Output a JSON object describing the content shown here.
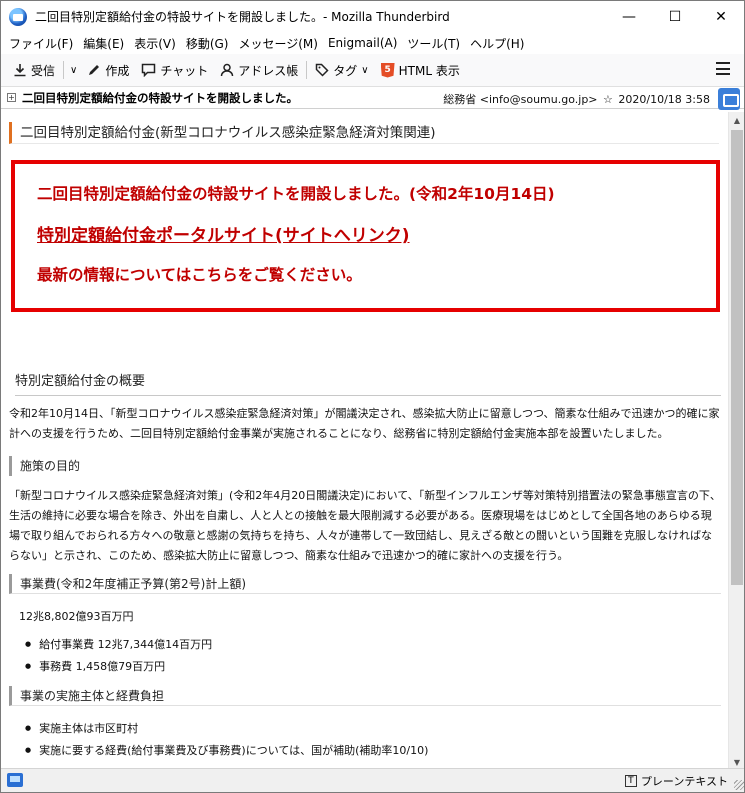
{
  "window": {
    "title": "二回目特別定額給付金の特設サイトを開設しました。- Mozilla Thunderbird",
    "minimize_glyph": "—",
    "maximize_glyph": "☐",
    "close_glyph": "✕"
  },
  "menubar": {
    "items": [
      "ファイル(F)",
      "編集(E)",
      "表示(V)",
      "移動(G)",
      "メッセージ(M)",
      "Enigmail(A)",
      "ツール(T)",
      "ヘルプ(H)"
    ]
  },
  "toolbar": {
    "get_messages": "受信",
    "write": "作成",
    "chat": "チャット",
    "address_book": "アドレス帳",
    "tag": "タグ",
    "html_view": "HTML 表示",
    "html_badge": "5",
    "dropdown_glyph": "∨"
  },
  "message_header": {
    "expand_glyph": "+",
    "subject": "二回目特別定額給付金の特設サイトを開設しました。",
    "sender": "総務省 <info@soumu.go.jp>",
    "star_glyph": "☆",
    "date": "2020/10/18 3:58"
  },
  "content": {
    "page_heading": "二回目特別定額給付金(新型コロナウイルス感染症緊急経済対策関連)",
    "red_box": {
      "line1": "二回目特別定額給付金の特設サイトを開設しました。(令和2年10月14日)",
      "link": "特別定額給付金ポータルサイト(サイトへリンク)",
      "line3": "最新の情報についてはこちらをご覧ください。"
    },
    "overview_title": "特別定額給付金の概要",
    "overview_text": "令和2年10月14日、「新型コロナウイルス感染症緊急経済対策」が閣議決定され、感染拡大防止に留意しつつ、簡素な仕組みで迅速かつ的確に家計への支援を行うため、二回目特別定額給付金事業が実施されることになり、総務省に特別定額給付金実施本部を設置いたしました。",
    "purpose_title": "施策の目的",
    "purpose_text": "「新型コロナウイルス感染症緊急経済対策」(令和2年4月20日閣議決定)において、「新型インフルエンザ等対策特別措置法の緊急事態宣言の下、生活の維持に必要な場合を除き、外出を自粛し、人と人との接触を最大限削減する必要がある。医療現場をはじめとして全国各地のあらゆる現場で取り組んでおられる方々への敬意と感謝の気持ちを持ち、人々が連帯して一致団結し、見えざる敵との闘いという国難を克服しなければならない」と示され、このため、感染拡大防止に留意しつつ、簡素な仕組みで迅速かつ的確に家計への支援を行う。",
    "budget_title": "事業費(令和2年度補正予算(第2号)計上額)",
    "budget_total": "12兆8,802億93百万円",
    "budget_items": [
      "給付事業費 12兆7,344億14百万円",
      "事務費 1,458億79百万円"
    ],
    "entity_title": "事業の実施主体と経費負担",
    "entity_items": [
      "実施主体は市区町村",
      "実施に要する経費(給付事業費及び事務費)については、国が補助(補助率10/10)"
    ]
  },
  "statusbar": {
    "format": "プレーンテキスト",
    "format_glyph": "T"
  }
}
